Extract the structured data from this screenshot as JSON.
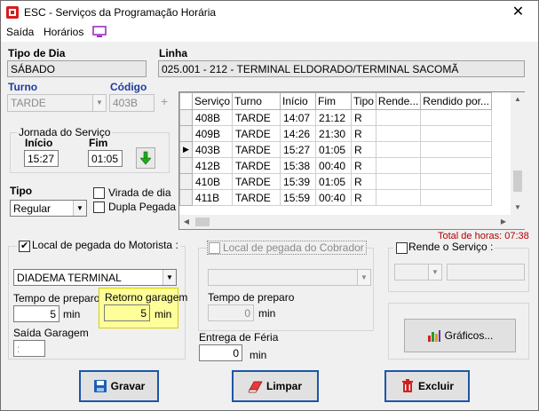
{
  "window": {
    "title": "ESC - Serviços da Programação Horária",
    "close": "✕"
  },
  "menu": {
    "items": [
      "Saída",
      "Horários"
    ]
  },
  "tipo_dia": {
    "label": "Tipo de Dia",
    "value": "SÁBADO"
  },
  "linha": {
    "label": "Linha",
    "value": "025.001 - 212 - TERMINAL ELDORADO/TERMINAL SACOMÃ"
  },
  "turno": {
    "label": "Turno",
    "value": "TARDE"
  },
  "codigo": {
    "label": "Código",
    "value": "403B",
    "add": "+"
  },
  "jornada": {
    "title": "Jornada do Serviço",
    "inicio_label": "Início",
    "inicio": "15:27",
    "fim_label": "Fim",
    "fim": "01:05"
  },
  "tipo": {
    "label": "Tipo",
    "value": "Regular"
  },
  "options": {
    "virada_dia": "Virada de dia",
    "dupla_pegada": "Dupla Pegada"
  },
  "grid": {
    "columns": [
      "Serviço",
      "Turno",
      "Início",
      "Fim",
      "Tipo",
      "Rende...",
      "Rendido por..."
    ],
    "rows": [
      [
        "408B",
        "TARDE",
        "14:07",
        "21:12",
        "R",
        "",
        ""
      ],
      [
        "409B",
        "TARDE",
        "14:26",
        "21:30",
        "R",
        "",
        ""
      ],
      [
        "403B",
        "TARDE",
        "15:27",
        "01:05",
        "R",
        "",
        ""
      ],
      [
        "412B",
        "TARDE",
        "15:38",
        "00:40",
        "R",
        "",
        ""
      ],
      [
        "410B",
        "TARDE",
        "15:39",
        "01:05",
        "R",
        "",
        ""
      ],
      [
        "411B",
        "TARDE",
        "15:59",
        "00:40",
        "R",
        "",
        ""
      ]
    ],
    "selected_row": 2,
    "total_horas": "Total de horas: 07:38"
  },
  "motorista": {
    "title": "Local de pegada do Motorista :",
    "checked": true,
    "local": "DIADEMA TERMINAL",
    "tempo_preparo_label": "Tempo de preparo",
    "tempo_preparo": "5",
    "min": "min",
    "retorno_label": "Retorno garagem",
    "retorno": "5",
    "saida_label": "Saída Garagem",
    "saida": ":"
  },
  "cobrador": {
    "title": "Local de pegada do Cobrador",
    "checked": false,
    "local": "",
    "tempo_preparo_label": "Tempo de preparo",
    "tempo_preparo": "0",
    "min": "min",
    "entrega_label": "Entrega de Féria",
    "entrega": "0"
  },
  "rende": {
    "title": "Rende o Serviço :",
    "checked": false
  },
  "buttons": {
    "graficos": "Gráficos...",
    "gravar": "Gravar",
    "limpar": "Limpar",
    "excluir": "Excluir"
  },
  "colors": {
    "accent_blue": "#1e3c9e",
    "total_red": "#b00000",
    "highlight": "#ffff99",
    "button_border": "#1c56a8"
  }
}
